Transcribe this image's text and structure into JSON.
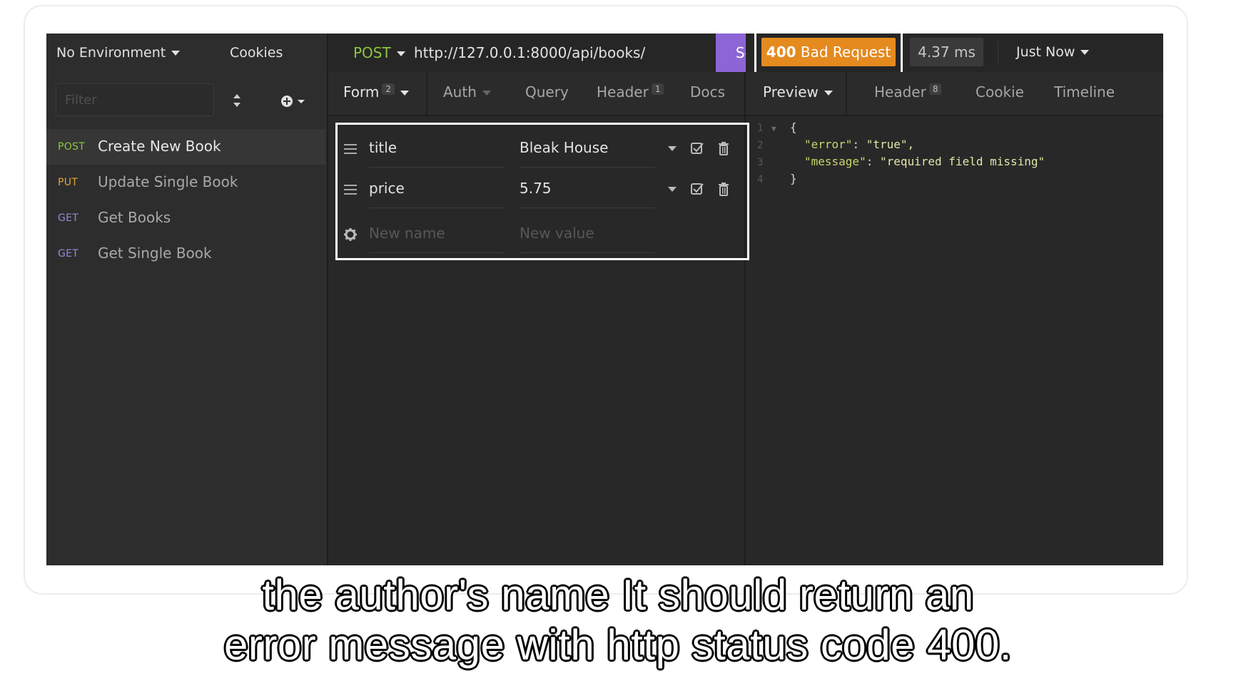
{
  "sidebar": {
    "environment_label": "No Environment",
    "cookies_label": "Cookies",
    "filter_placeholder": "Filter",
    "requests": [
      {
        "method": "POST",
        "method_color": "#8dc63f",
        "name": "Create New Book",
        "active": true
      },
      {
        "method": "PUT",
        "method_color": "#e3a53b",
        "name": "Update Single Book",
        "active": false
      },
      {
        "method": "GET",
        "method_color": "#9b86d9",
        "name": "Get Books",
        "active": false
      },
      {
        "method": "GET",
        "method_color": "#9b86d9",
        "name": "Get Single Book",
        "active": false
      }
    ]
  },
  "request": {
    "method": "POST",
    "url": "http://127.0.0.1:8000/api/books/",
    "send_label": "Send",
    "tabs": [
      {
        "label": "Form",
        "count": "2"
      },
      {
        "label": "Auth",
        "count": ""
      },
      {
        "label": "Query",
        "count": ""
      },
      {
        "label": "Header",
        "count": "1"
      },
      {
        "label": "Docs",
        "count": ""
      }
    ],
    "params": [
      {
        "name": "title",
        "value": "Bleak House"
      },
      {
        "name": "price",
        "value": "5.75"
      }
    ],
    "new_name_placeholder": "New name",
    "new_value_placeholder": "New value"
  },
  "response": {
    "status_code": "400",
    "status_text": "Bad Request",
    "status_color": "#e48a1f",
    "time": "4.37 ms",
    "history_label": "Just Now",
    "tabs": [
      {
        "label": "Preview",
        "count": ""
      },
      {
        "label": "Header",
        "count": "8"
      },
      {
        "label": "Cookie",
        "count": ""
      },
      {
        "label": "Timeline",
        "count": ""
      }
    ],
    "body_lines": [
      {
        "no": "1",
        "text": "{"
      },
      {
        "no": "2",
        "key": "\"error\"",
        "value": "\"true\","
      },
      {
        "no": "3",
        "key": "\"message\"",
        "value": "\"required field missing\""
      },
      {
        "no": "4",
        "text": "}"
      }
    ]
  },
  "captions": {
    "line1": "the author's name It should return an",
    "line2": "error message with http status code 400."
  },
  "colors": {
    "accent_send": "#8d65d6",
    "app_background": "#282828"
  }
}
